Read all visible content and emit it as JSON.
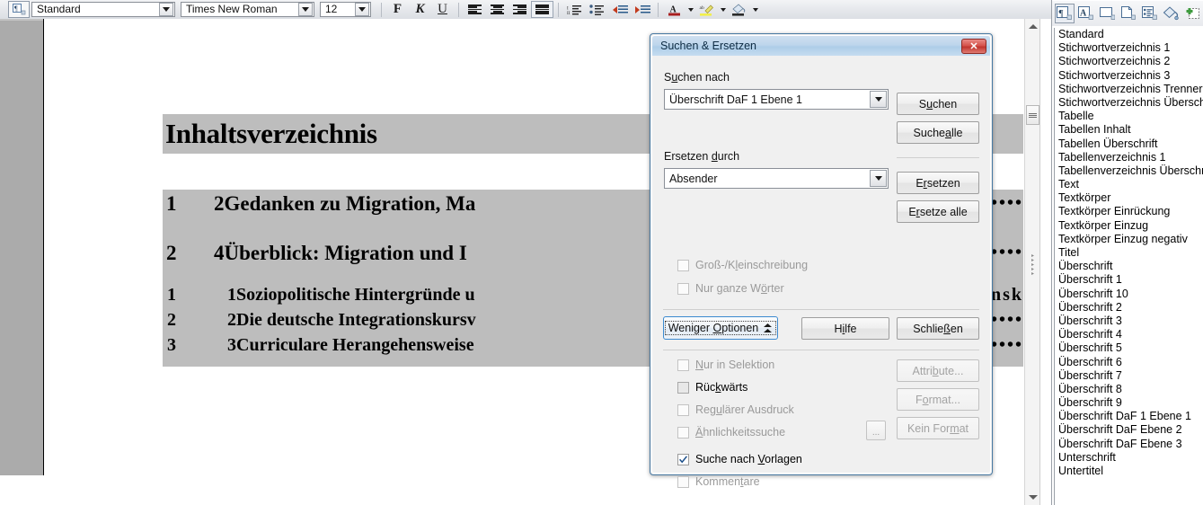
{
  "toolbar": {
    "paragraph_style": "Standard",
    "font_name": "Times New Roman",
    "font_size": "12",
    "bold_label": "F",
    "italic_label": "K",
    "underline_label": "U",
    "icons": [
      "align-left-icon",
      "align-center-icon",
      "align-right-icon",
      "justify-icon",
      "ordered-list-icon",
      "unordered-list-icon",
      "decrease-indent-icon",
      "increase-indent-icon",
      "font-color-icon",
      "highlight-color-icon",
      "background-color-icon"
    ],
    "overflow_label": "»"
  },
  "document": {
    "toc_title": "Inhaltsverzeichnis",
    "entries": [
      {
        "level": 1,
        "num": "1",
        "text": "2Gedanken zu Migration, Ma",
        "dots": "•••••"
      },
      {
        "level": 1,
        "num": "2",
        "text": "4Überblick: Migration und I",
        "dots": "l••••"
      },
      {
        "level": 2,
        "num": "1",
        "text": "1Soziopolitische Hintergründe u",
        "dots": "onsk"
      },
      {
        "level": 2,
        "num": "2",
        "text": "2Die deutsche Integrationskursv",
        "dots": "•••••"
      },
      {
        "level": 2,
        "num": "3",
        "text": "3Curriculare Herangehensweise",
        "dots": "•••••"
      }
    ]
  },
  "dialog": {
    "title": "Suchen & Ersetzen",
    "close_label": "✕",
    "search_label_pre": "S",
    "search_label_key": "u",
    "search_label_post": "chen nach",
    "search_value": "Überschrift DaF 1 Ebene 1",
    "replace_label_pre": "Ersetzen ",
    "replace_label_key": "d",
    "replace_label_post": "urch",
    "replace_value": "Absender",
    "buttons": {
      "search": {
        "pre": "S",
        "key": "u",
        "post": "chen",
        "enabled": true
      },
      "search_all": {
        "pre": "Suche ",
        "key": "a",
        "post": "lle",
        "enabled": true
      },
      "replace": {
        "pre": "E",
        "key": "r",
        "post": "setzen",
        "enabled": true
      },
      "replace_all": {
        "pre": "E",
        "key": "r",
        "post": "setze alle",
        "enabled": true
      },
      "fewer_options": {
        "pre": "Weniger ",
        "key": "O",
        "post": "ptionen",
        "enabled": true
      },
      "help": {
        "pre": "H",
        "key": "i",
        "post": "lfe",
        "enabled": true
      },
      "close": {
        "pre": "Schlie",
        "key": "ß",
        "post": "en",
        "enabled": true
      },
      "attributes": {
        "pre": "Attri",
        "key": "b",
        "post": "ute...",
        "enabled": false
      },
      "format": {
        "pre": "F",
        "key": "o",
        "post": "rmat...",
        "enabled": false
      },
      "no_format": {
        "pre": "Kein For",
        "key": "m",
        "post": "at",
        "enabled": false
      },
      "similarity_ellipsis": "..."
    },
    "checkboxes": [
      {
        "pre": "Groß-/K",
        "key": "l",
        "post": "einschreibung",
        "checked": false,
        "enabled": false
      },
      {
        "pre": "Nur ganze W",
        "key": "ö",
        "post": "rter",
        "checked": false,
        "enabled": false
      },
      {
        "pre": "",
        "key": "N",
        "post": "ur in Selektion",
        "checked": false,
        "enabled": false
      },
      {
        "pre": "Rüc",
        "key": "k",
        "post": "wärts",
        "checked": false,
        "enabled": true
      },
      {
        "pre": "Reg",
        "key": "u",
        "post": "lärer Ausdruck",
        "checked": false,
        "enabled": false
      },
      {
        "pre": "",
        "key": "Ä",
        "post": "hnlichkeitssuche",
        "checked": false,
        "enabled": false
      },
      {
        "pre": "Suche nach ",
        "key": "V",
        "post": "orlagen",
        "checked": true,
        "enabled": true
      },
      {
        "pre": "Kommen",
        "key": "t",
        "post": "are",
        "checked": false,
        "enabled": false
      }
    ]
  },
  "sidebar": {
    "toolbar_icons": [
      "paragraph-styles-icon",
      "character-styles-icon",
      "frame-styles-icon",
      "page-styles-icon",
      "list-styles-icon",
      "fill-format-mode-icon",
      "new-style-icon"
    ],
    "styles": [
      "Standard",
      "Stichwortverzeichnis 1",
      "Stichwortverzeichnis 2",
      "Stichwortverzeichnis 3",
      "Stichwortverzeichnis Trenner",
      "Stichwortverzeichnis Überschrift",
      "Tabelle",
      "Tabellen Inhalt",
      "Tabellen Überschrift",
      "Tabellenverzeichnis 1",
      "Tabellenverzeichnis Überschrift",
      "Text",
      "Textkörper",
      "Textkörper Einrückung",
      "Textkörper Einzug",
      "Textkörper Einzug negativ",
      "Titel",
      "Überschrift",
      "Überschrift 1",
      "Überschrift 10",
      "Überschrift 2",
      "Überschrift 3",
      "Überschrift 4",
      "Überschrift 5",
      "Überschrift 6",
      "Überschrift 7",
      "Überschrift 8",
      "Überschrift 9",
      "Überschrift DaF 1 Ebene 1",
      "Überschrift DaF Ebene 2",
      "Überschrift DaF Ebene 3",
      "Unterschrift",
      "Untertitel"
    ],
    "selected_style": "Standard"
  },
  "colors": {
    "accent": "#3c8ad0",
    "title_gradient_top": "#cfe0f0",
    "title_gradient_bottom": "#aecde8",
    "close_red": "#c0352e",
    "dialog_bg": "#f0f0f0",
    "doc_shade": "#bdbdbd",
    "selection_gray": "#d4d4d4"
  }
}
